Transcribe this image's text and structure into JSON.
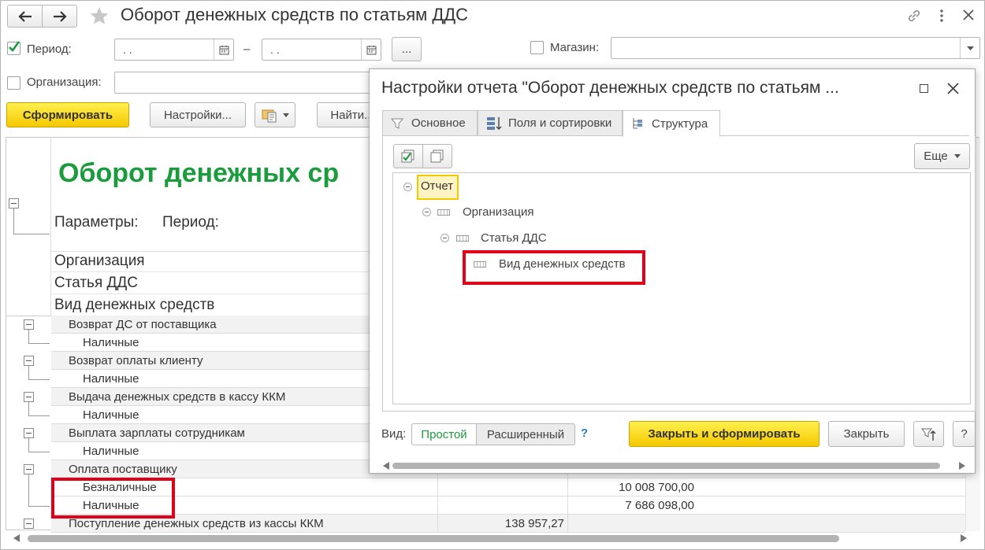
{
  "window": {
    "title": "Оборот денежных средств по статьям ДДС"
  },
  "filters": {
    "period_label": "Период:",
    "period_from": ". .",
    "period_dash": "–",
    "period_to": ". .",
    "more_label": "...",
    "shop_label": "Магазин:",
    "org_label": "Организация:"
  },
  "toolbar": {
    "generate": "Сформировать",
    "settings": "Настройки...",
    "find": "Найти..."
  },
  "report": {
    "title": "Оборот денежных ср",
    "params_label": "Параметры:",
    "period_param": "Период:",
    "group_headers": [
      "Организация",
      "Статья ДДС",
      "Вид денежных средств"
    ],
    "rows": [
      {
        "label": "Возврат ДС от поставщика",
        "level": 0,
        "c1": "",
        "c2": ""
      },
      {
        "label": "Наличные",
        "level": 1,
        "c1": "",
        "c2": ""
      },
      {
        "label": "Возврат оплаты клиенту",
        "level": 0,
        "c1": "",
        "c2": ""
      },
      {
        "label": "Наличные",
        "level": 1,
        "c1": "",
        "c2": ""
      },
      {
        "label": "Выдача денежных средств в кассу ККМ",
        "level": 0,
        "c1": "",
        "c2": ""
      },
      {
        "label": "Наличные",
        "level": 1,
        "c1": "",
        "c2": ""
      },
      {
        "label": "Выплата зарплаты сотрудникам",
        "level": 0,
        "c1": "",
        "c2": ""
      },
      {
        "label": "Наличные",
        "level": 1,
        "c1": "",
        "c2": ""
      },
      {
        "label": "Оплата поставщику",
        "level": 0,
        "c1": "",
        "c2": ""
      },
      {
        "label": "Безналичные",
        "level": 1,
        "c1": "",
        "c2": "10 008 700,00"
      },
      {
        "label": "Наличные",
        "level": 1,
        "c1": "",
        "c2": "7 686 098,00"
      },
      {
        "label": "Поступление денежных средств из кассы ККМ",
        "level": 0,
        "c1": "138 957,27",
        "c2": ""
      }
    ]
  },
  "dialog": {
    "title": "Настройки отчета \"Оборот денежных средств по статьям ...",
    "tabs": [
      "Основное",
      "Поля и сортировки",
      "Структура"
    ],
    "more": "Еще",
    "tree": {
      "root": "Отчет",
      "level1": "Организация",
      "level2": "Статья ДДС",
      "level3": "Вид денежных средств"
    },
    "view_label": "Вид:",
    "view_simple": "Простой",
    "view_extended": "Расширенный",
    "help": "?",
    "close_and_generate": "Закрыть и сформировать",
    "close": "Закрыть"
  },
  "colors": {
    "accent_green": "#1a9c3c",
    "highlight_red": "#e0001a",
    "button_yellow": "#f5c800"
  }
}
